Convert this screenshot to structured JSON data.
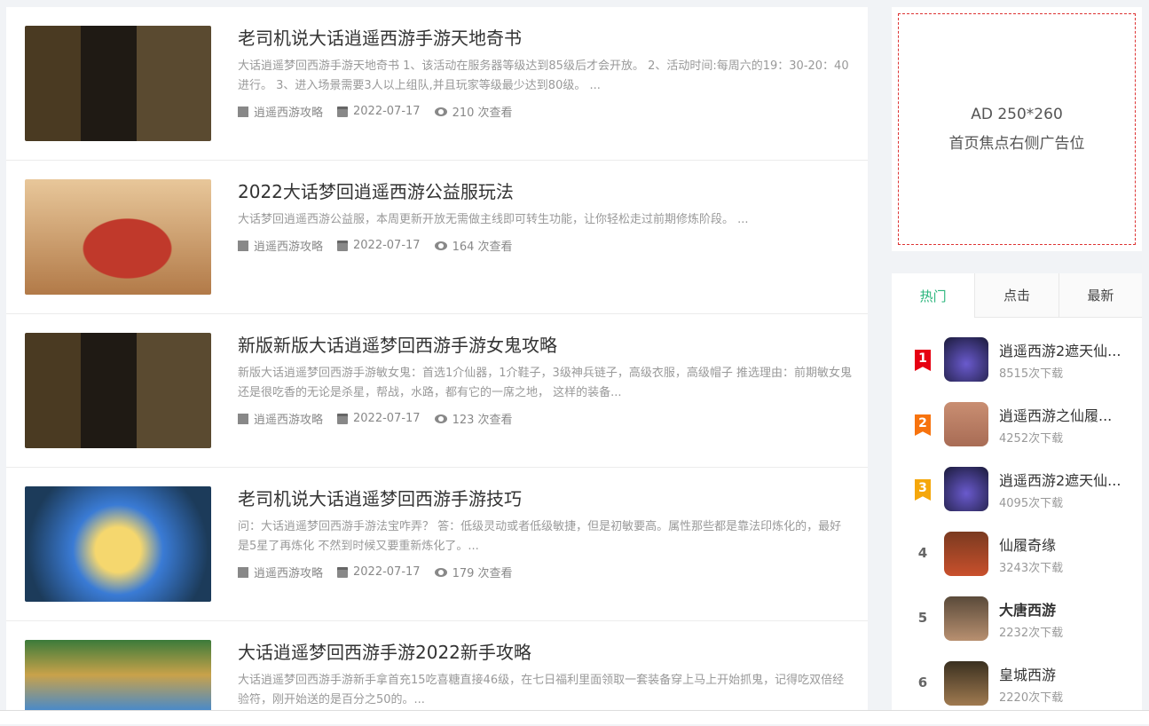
{
  "articles": [
    {
      "title": "老司机说大话逍遥西游手游天地奇书",
      "desc": "大话逍遥梦回西游手游天地奇书 1、该活动在服务器等级达到85级后才会开放。 2、活动时间:每周六的19：30-20：40进行。 3、进入场景需要3人以上组队,并且玩家等级最少达到80级。 ...",
      "category": "逍遥西游攻略",
      "date": "2022-07-17",
      "views": "210 次查看"
    },
    {
      "title": "2022大话梦回逍遥西游公益服玩法",
      "desc": "大话梦回逍遥西游公益服，本周更新开放无需做主线即可转生功能，让你轻松走过前期修炼阶段。 ...",
      "category": "逍遥西游攻略",
      "date": "2022-07-17",
      "views": "164 次查看"
    },
    {
      "title": "新版新版大话逍遥梦回西游手游女鬼攻略",
      "desc": "新版大话逍遥梦回西游手游敏女鬼：首选1介仙器，1介鞋子，3级神兵链子，高级衣服，高级帽子 推选理由：前期敏女鬼还是很吃香的无论是杀星，帮战，水路，都有它的一席之地， 这样的装备...",
      "category": "逍遥西游攻略",
      "date": "2022-07-17",
      "views": "123 次查看"
    },
    {
      "title": "老司机说大话逍遥梦回西游手游技巧",
      "desc": "问：大话逍遥梦回西游手游法宝咋弄？ 答：低级灵动或者低级敏捷，但是初敏要高。属性那些都是靠法印炼化的，最好是5星了再炼化 不然到时候又要重新炼化了。...",
      "category": "逍遥西游攻略",
      "date": "2022-07-17",
      "views": "179 次查看"
    },
    {
      "title": "大话逍遥梦回西游手游2022新手攻略",
      "desc": "大话逍遥梦回西游手游新手拿首充15吃喜糖直接46级，在七日福利里面领取一套装备穿上马上开始抓鬼，记得吃双倍经验符，刚开始送的是百分之50的。..."
    }
  ],
  "ad": {
    "line1": "AD 250*260",
    "line2": "首页焦点右侧广告位"
  },
  "tabs": [
    "热门",
    "点击",
    "最新"
  ],
  "ranking": [
    {
      "rank": "1",
      "name": "逍遥西游2遮天仙...",
      "downloads": "8515次下载",
      "color": "#e60012"
    },
    {
      "rank": "2",
      "name": "逍遥西游之仙履...",
      "downloads": "4252次下载",
      "color": "#f7730e"
    },
    {
      "rank": "3",
      "name": "逍遥西游2遮天仙...",
      "downloads": "4095次下载",
      "color": "#f5a70b"
    },
    {
      "rank": "4",
      "name": "仙履奇缘",
      "downloads": "3243次下载"
    },
    {
      "rank": "5",
      "name": "大唐西游",
      "downloads": "2232次下载"
    },
    {
      "rank": "6",
      "name": "皇城西游",
      "downloads": "2220次下载"
    }
  ]
}
